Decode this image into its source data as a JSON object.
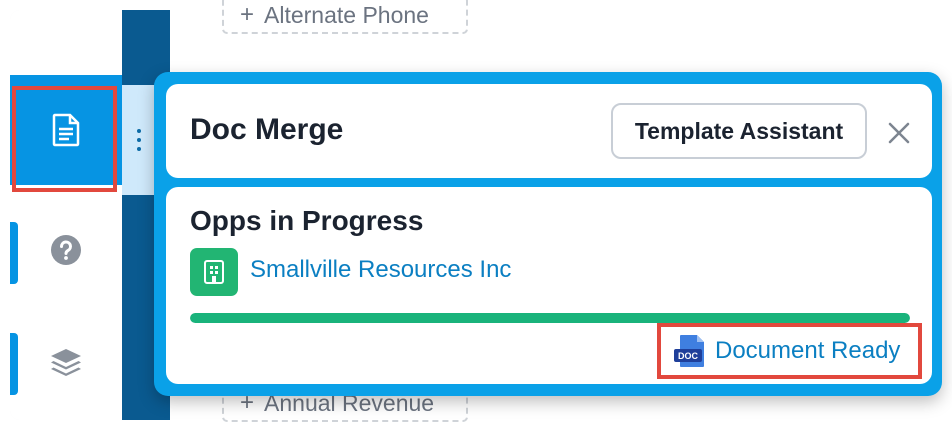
{
  "background_fields": {
    "top_button_label": "Alternate Phone",
    "bottom_button_label": "Annual Revenue"
  },
  "sidebar": {
    "items": [
      {
        "name": "documents",
        "icon": "document-icon"
      },
      {
        "name": "help",
        "icon": "help-circle-icon"
      },
      {
        "name": "layers",
        "icon": "layers-icon"
      }
    ]
  },
  "panel": {
    "title": "Doc Merge",
    "template_button": "Template Assistant",
    "section_title": "Opps in Progress",
    "record_name": "Smallville Resources Inc",
    "progress": 1.0,
    "doc_badge": "DOC",
    "status_link": "Document Ready"
  },
  "colors": {
    "accent": "#0aa1e8",
    "dark_rail": "#0a5a90",
    "success": "#19b37b",
    "link": "#0b7fc2",
    "highlight": "#e2483d"
  }
}
